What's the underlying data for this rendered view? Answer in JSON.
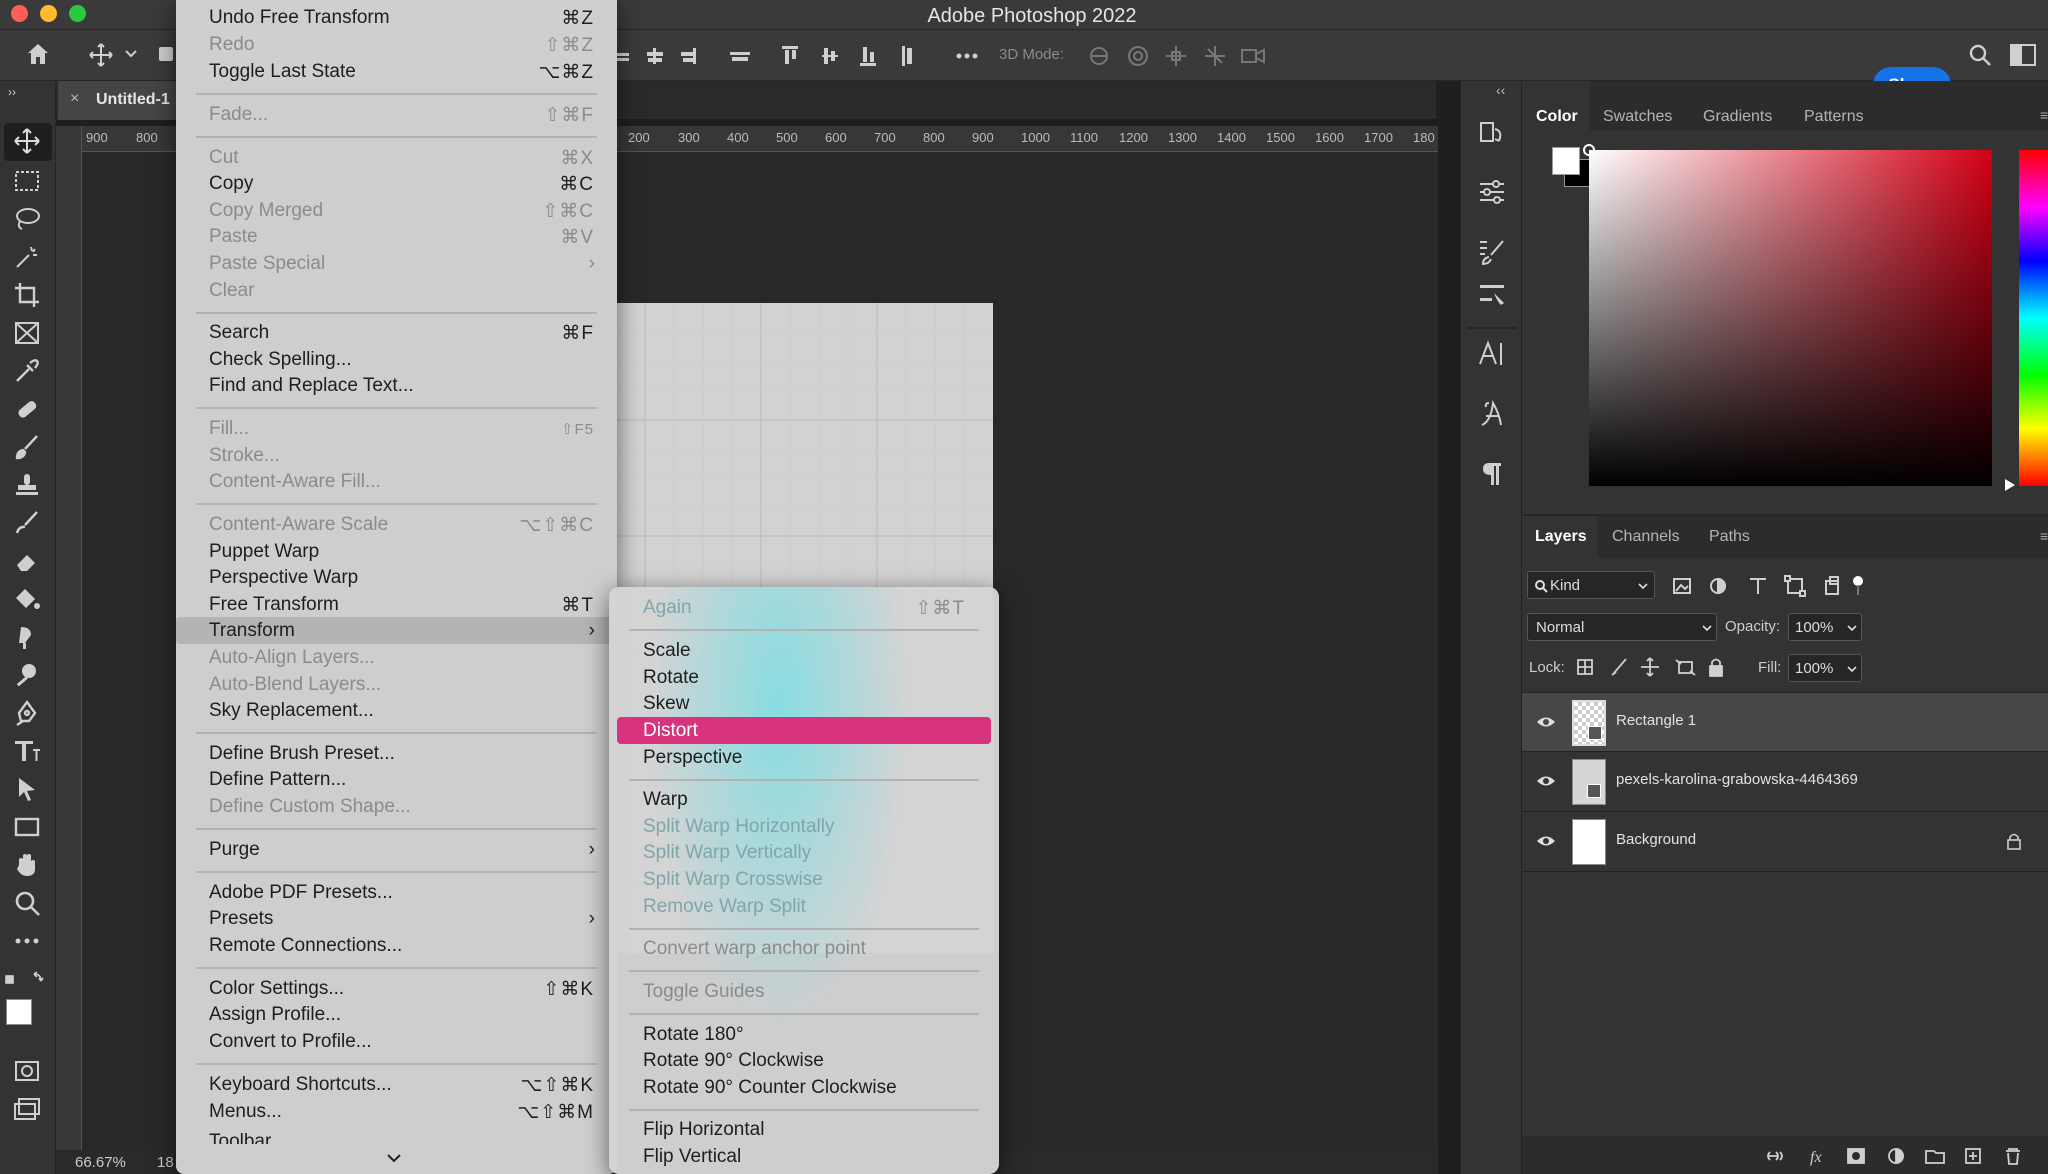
{
  "app_title": "Adobe Photoshop 2022",
  "options_bar": {
    "mode_3d_label": "3D Mode:",
    "share_label": "Share"
  },
  "document": {
    "tab_title": "Untitled-1",
    "zoom": "66.67%",
    "status_fragment": "18",
    "ruler_labels": [
      "900",
      "800",
      "200",
      "300",
      "400",
      "500",
      "600",
      "700",
      "800",
      "900",
      "1000",
      "1100",
      "1200",
      "1300",
      "1400",
      "1500",
      "1600",
      "1700",
      "180"
    ]
  },
  "color_panel": {
    "tabs": [
      "Color",
      "Swatches",
      "Gradients",
      "Patterns"
    ],
    "active_tab": "Color",
    "colors": {
      "hue_base": "#d40016",
      "foreground": "#ffffff",
      "background": "#000000"
    }
  },
  "layers_panel": {
    "tabs": [
      "Layers",
      "Channels",
      "Paths"
    ],
    "active_tab": "Layers",
    "filter_kind": "Kind",
    "blend_mode": "Normal",
    "opacity_label": "Opacity:",
    "opacity_value": "100%",
    "lock_label": "Lock:",
    "fill_label": "Fill:",
    "fill_value": "100%",
    "layers": [
      {
        "name": "Rectangle 1",
        "visible": true,
        "selected": true
      },
      {
        "name": "pexels-karolina-grabowska-4464369",
        "visible": true,
        "selected": false
      },
      {
        "name": "Background",
        "visible": true,
        "selected": false,
        "locked": true
      }
    ]
  },
  "edit_menu": {
    "items": [
      {
        "label": "Undo Free Transform",
        "shortcut": "⌘Z"
      },
      {
        "label": "Redo",
        "shortcut": "⇧⌘Z",
        "disabled": true
      },
      {
        "label": "Toggle Last State",
        "shortcut": "⌥⌘Z"
      },
      {
        "label": "Fade...",
        "shortcut": "⇧⌘F",
        "disabled": true
      },
      {
        "label": "Cut",
        "shortcut": "⌘X",
        "disabled": true
      },
      {
        "label": "Copy",
        "shortcut": "⌘C"
      },
      {
        "label": "Copy Merged",
        "shortcut": "⇧⌘C",
        "disabled": true
      },
      {
        "label": "Paste",
        "shortcut": "⌘V",
        "disabled": true
      },
      {
        "label": "Paste Special",
        "disabled": true,
        "submenu": true
      },
      {
        "label": "Clear",
        "disabled": true
      },
      {
        "label": "Search",
        "shortcut": "⌘F"
      },
      {
        "label": "Check Spelling..."
      },
      {
        "label": "Find and Replace Text..."
      },
      {
        "label": "Fill...",
        "shortcut": "⇧F5",
        "disabled": true
      },
      {
        "label": "Stroke...",
        "disabled": true
      },
      {
        "label": "Content-Aware Fill...",
        "disabled": true
      },
      {
        "label": "Content-Aware Scale",
        "shortcut": "⌥⇧⌘C",
        "disabled": true
      },
      {
        "label": "Puppet Warp"
      },
      {
        "label": "Perspective Warp"
      },
      {
        "label": "Free Transform",
        "shortcut": "⌘T"
      },
      {
        "label": "Transform",
        "submenu": true,
        "selected": true
      },
      {
        "label": "Auto-Align Layers...",
        "disabled": true
      },
      {
        "label": "Auto-Blend Layers...",
        "disabled": true
      },
      {
        "label": "Sky Replacement..."
      },
      {
        "label": "Define Brush Preset..."
      },
      {
        "label": "Define Pattern..."
      },
      {
        "label": "Define Custom Shape...",
        "disabled": true
      },
      {
        "label": "Purge",
        "submenu": true
      },
      {
        "label": "Adobe PDF Presets..."
      },
      {
        "label": "Presets",
        "submenu": true
      },
      {
        "label": "Remote Connections..."
      },
      {
        "label": "Color Settings...",
        "shortcut": "⇧⌘K"
      },
      {
        "label": "Assign Profile..."
      },
      {
        "label": "Convert to Profile..."
      },
      {
        "label": "Keyboard Shortcuts...",
        "shortcut": "⌥⇧⌘K"
      },
      {
        "label": "Menus...",
        "shortcut": "⌥⇧⌘M"
      },
      {
        "label": "Toolbar..."
      }
    ]
  },
  "transform_submenu": {
    "items": [
      {
        "label": "Again",
        "shortcut": "⇧⌘T",
        "disabled": true
      },
      {
        "label": "Scale"
      },
      {
        "label": "Rotate"
      },
      {
        "label": "Skew"
      },
      {
        "label": "Distort",
        "highlighted": true
      },
      {
        "label": "Perspective"
      },
      {
        "label": "Warp"
      },
      {
        "label": "Split Warp Horizontally",
        "disabled": true
      },
      {
        "label": "Split Warp Vertically",
        "disabled": true
      },
      {
        "label": "Split Warp Crosswise",
        "disabled": true
      },
      {
        "label": "Remove Warp Split",
        "disabled": true
      },
      {
        "label": "Convert warp anchor point",
        "disabled": true
      },
      {
        "label": "Toggle Guides",
        "disabled": true
      },
      {
        "label": "Rotate 180°"
      },
      {
        "label": "Rotate 90° Clockwise"
      },
      {
        "label": "Rotate 90° Counter Clockwise"
      },
      {
        "label": "Flip Horizontal"
      },
      {
        "label": "Flip Vertical"
      }
    ]
  }
}
